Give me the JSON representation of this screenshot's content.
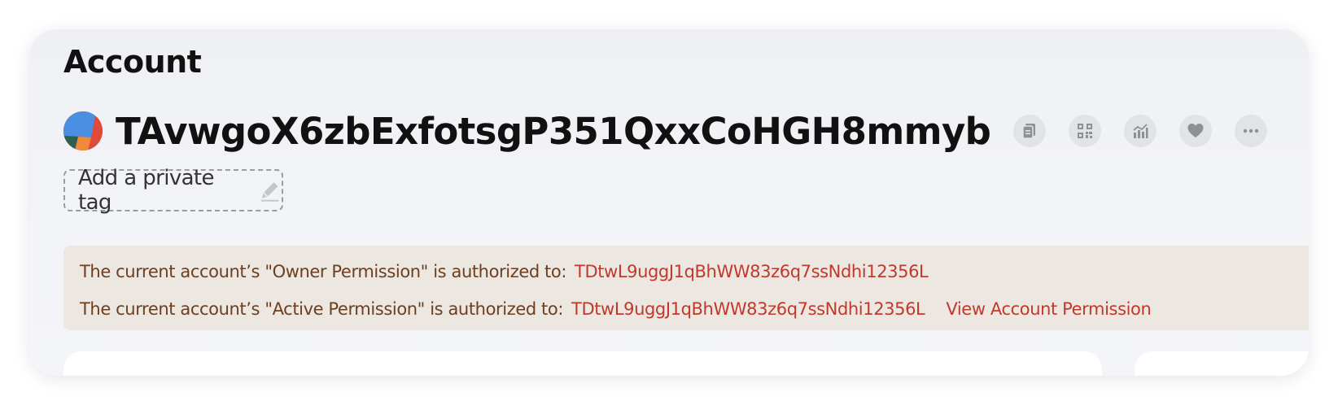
{
  "header": {
    "title": "Account"
  },
  "account": {
    "address": "TAvwgoX6zbExfotsgP351QxxCoHGH8mmyb",
    "avatar_colors": [
      "#4a90e2",
      "#e04a3a",
      "#f08a3a",
      "#2e5f4f"
    ],
    "actions": [
      {
        "name": "copy-icon"
      },
      {
        "name": "qr-code-icon"
      },
      {
        "name": "chart-icon"
      },
      {
        "name": "heart-icon"
      },
      {
        "name": "more-icon"
      }
    ]
  },
  "tag": {
    "label": "Add a private tag",
    "icon": "pencil-icon"
  },
  "permissions": {
    "owner_text": "The current account’s \"Owner Permission\" is authorized to:",
    "owner_address": "TDtwL9uggJ1qBhWW83z6q7ssNdhi12356L",
    "active_text": "The current account’s \"Active Permission\" is authorized to:",
    "active_address": "TDtwL9uggJ1qBhWW83z6q7ssNdhi12356L",
    "view_link": "View Account Permission",
    "text_color": "#6b3f1f",
    "link_color": "#c0392b",
    "background": "#ece7e1"
  }
}
